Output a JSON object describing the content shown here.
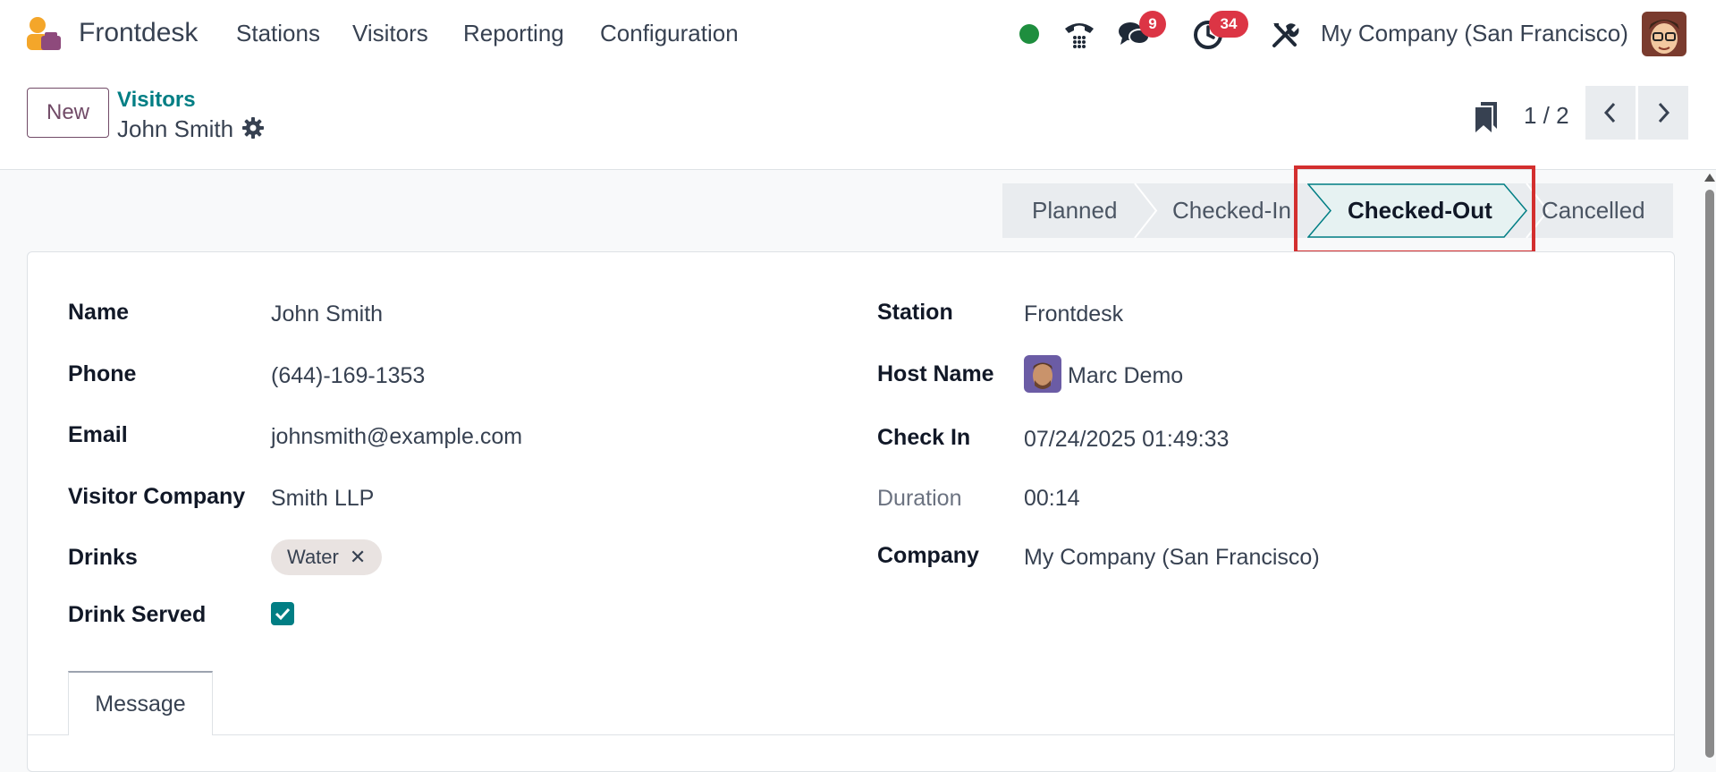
{
  "nav": {
    "app_name": "Frontdesk",
    "menus": [
      "Stations",
      "Visitors",
      "Reporting",
      "Configuration"
    ],
    "messages_badge": "9",
    "activities_badge": "34",
    "company": "My Company (San Francisco)",
    "colors": {
      "presence": "#1e8e3e",
      "badge": "#dc3545"
    }
  },
  "control": {
    "new_label": "New",
    "breadcrumb_parent": "Visitors",
    "breadcrumb_current": "John Smith",
    "pager_value": "1 / 2"
  },
  "status": {
    "stages": [
      "Planned",
      "Checked-In",
      "Checked-Out",
      "Cancelled"
    ],
    "current": "Checked-Out"
  },
  "form": {
    "name_label": "Name",
    "name": "John Smith",
    "phone_label": "Phone",
    "phone": "(644)-169-1353",
    "email_label": "Email",
    "email": "johnsmith@example.com",
    "visitor_company_label": "Visitor Company",
    "visitor_company": "Smith LLP",
    "drinks_label": "Drinks",
    "drink_tag": "Water",
    "drink_served_label": "Drink Served",
    "drink_served": true,
    "station_label": "Station",
    "station": "Frontdesk",
    "host_label": "Host Name",
    "host": "Marc Demo",
    "checkin_label": "Check In",
    "checkin": "07/24/2025 01:49:33",
    "duration_label": "Duration",
    "duration": "00:14",
    "company_label": "Company",
    "company": "My Company (San Francisco)"
  },
  "tabs": [
    "Message"
  ]
}
